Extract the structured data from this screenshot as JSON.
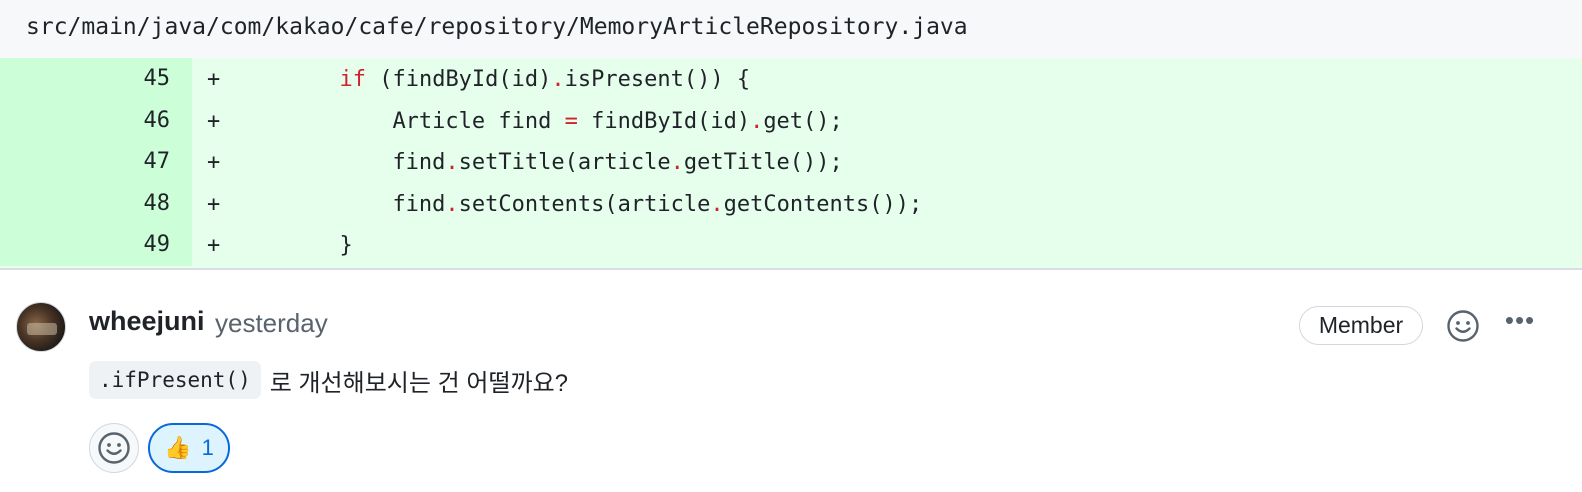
{
  "file": {
    "path": "src/main/java/com/kakao/cafe/repository/MemoryArticleRepository.java"
  },
  "diff": {
    "lines": [
      {
        "number": "45",
        "marker": "+"
      },
      {
        "number": "46",
        "marker": "+"
      },
      {
        "number": "47",
        "marker": "+"
      },
      {
        "number": "48",
        "marker": "+"
      },
      {
        "number": "49",
        "marker": "+"
      }
    ],
    "code": {
      "l45_kw": "if",
      "l45_a": " (findById(id)",
      "l45_dot": ".",
      "l45_b": "isPresent()) {",
      "l46_a": "Article find ",
      "l46_eq": "=",
      "l46_b": " findById(id)",
      "l46_dot": ".",
      "l46_c": "get();",
      "l47_a": "find",
      "l47_dot1": ".",
      "l47_b": "setTitle(article",
      "l47_dot2": ".",
      "l47_c": "getTitle());",
      "l48_a": "find",
      "l48_dot1": ".",
      "l48_b": "setContents(article",
      "l48_dot2": ".",
      "l48_c": "getContents());",
      "l49_a": "}"
    }
  },
  "comment": {
    "author": "wheejuni",
    "timestamp": "yesterday",
    "badge": "Member",
    "more_label": "•••",
    "body_code": ".ifPresent()",
    "body_text": "로 개선해보시는 건 어떨까요?",
    "reactions": [
      {
        "emoji": "👍",
        "count": "1"
      }
    ]
  },
  "colors": {
    "added_bg": "#e6ffec",
    "added_gutter": "#ccffd8",
    "keyword": "#cf222e",
    "accent": "#0969da"
  }
}
